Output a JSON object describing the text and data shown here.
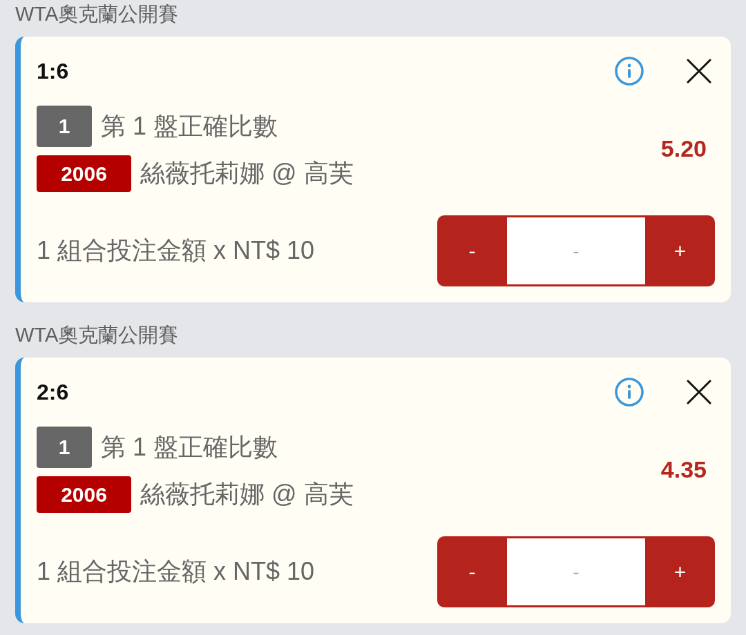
{
  "sections": [
    {
      "title": "WTA奧克蘭公開賽",
      "bet": {
        "score": "1:6",
        "legs": [
          {
            "kind": "market",
            "code": "1",
            "text": "第 1 盤正確比數"
          },
          {
            "kind": "selection",
            "code": "2006",
            "text": "絲薇托莉娜 @ 高芙"
          }
        ],
        "odds": "5.20",
        "stake_label": "1 組合投注金額 x NT$ 10",
        "stepper": {
          "minus": "-",
          "placeholder": "-",
          "plus": "+"
        }
      }
    },
    {
      "title": "WTA奧克蘭公開賽",
      "bet": {
        "score": "2:6",
        "legs": [
          {
            "kind": "market",
            "code": "1",
            "text": "第 1 盤正確比數"
          },
          {
            "kind": "selection",
            "code": "2006",
            "text": "絲薇托莉娜 @ 高芙"
          }
        ],
        "odds": "4.35",
        "stake_label": "1 組合投注金額 x NT$ 10",
        "stepper": {
          "minus": "-",
          "placeholder": "-",
          "plus": "+"
        }
      }
    }
  ]
}
